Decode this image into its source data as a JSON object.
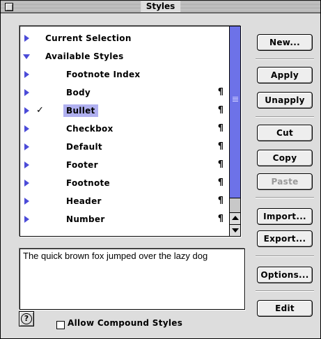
{
  "window": {
    "title": "Styles"
  },
  "styles_list": {
    "rows": [
      {
        "label": "Current Selection",
        "expanded": false,
        "checked": false,
        "paragraph_mark": false,
        "selected": false
      },
      {
        "label": "Available Styles",
        "expanded": true,
        "checked": false,
        "paragraph_mark": false,
        "selected": false
      },
      {
        "label": "Footnote Index",
        "expanded": false,
        "checked": false,
        "paragraph_mark": false,
        "selected": false
      },
      {
        "label": "Body",
        "expanded": false,
        "checked": false,
        "paragraph_mark": true,
        "selected": false
      },
      {
        "label": "Bullet",
        "expanded": false,
        "checked": true,
        "paragraph_mark": true,
        "selected": true
      },
      {
        "label": "Checkbox",
        "expanded": false,
        "checked": false,
        "paragraph_mark": true,
        "selected": false
      },
      {
        "label": "Default",
        "expanded": false,
        "checked": false,
        "paragraph_mark": true,
        "selected": false
      },
      {
        "label": "Footer",
        "expanded": false,
        "checked": false,
        "paragraph_mark": true,
        "selected": false
      },
      {
        "label": "Footnote",
        "expanded": false,
        "checked": false,
        "paragraph_mark": true,
        "selected": false
      },
      {
        "label": "Header",
        "expanded": false,
        "checked": false,
        "paragraph_mark": true,
        "selected": false
      },
      {
        "label": "Number",
        "expanded": false,
        "checked": false,
        "paragraph_mark": true,
        "selected": false
      }
    ],
    "check_glyph": "✓",
    "paragraph_glyph": "¶"
  },
  "preview": {
    "text": "The quick brown fox jumped over the lazy dog"
  },
  "buttons": {
    "new": "New...",
    "apply": "Apply",
    "unapply": "Unapply",
    "cut": "Cut",
    "copy": "Copy",
    "paste": "Paste",
    "import": "Import...",
    "export": "Export...",
    "options": "Options...",
    "edit": "Edit"
  },
  "footer": {
    "help_glyph": "?",
    "allow_compound_label": "Allow Compound Styles",
    "allow_compound_checked": false
  },
  "colors": {
    "accent": "#6d72e8",
    "disclosure_triangle": "#4b4bd8",
    "selection": "#b0b0f0"
  }
}
